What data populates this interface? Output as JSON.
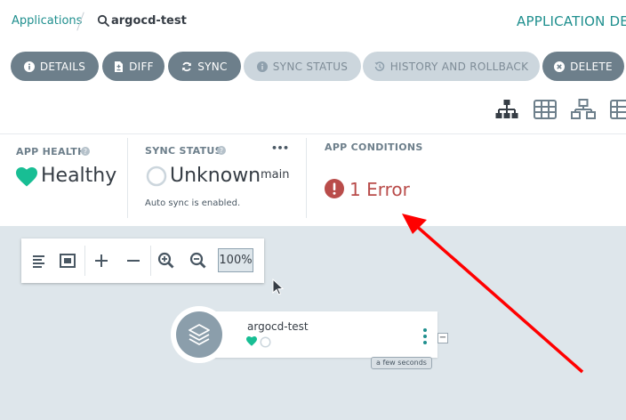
{
  "breadcrumb": {
    "root": "Applications",
    "current": "argocd-test"
  },
  "header": {
    "title": "APPLICATION DET"
  },
  "actions": [
    {
      "label": "DETAILS",
      "icon": "info-icon",
      "enabled": true
    },
    {
      "label": "DIFF",
      "icon": "file-diff-icon",
      "enabled": true
    },
    {
      "label": "SYNC",
      "icon": "sync-icon",
      "enabled": true
    },
    {
      "label": "SYNC STATUS",
      "icon": "info-icon",
      "enabled": false
    },
    {
      "label": "HISTORY AND ROLLBACK",
      "icon": "history-icon",
      "enabled": false
    },
    {
      "label": "DELETE",
      "icon": "close-circle-icon",
      "enabled": true
    }
  ],
  "views": [
    "tree-view-icon",
    "pods-view-icon",
    "network-view-icon",
    "list-view-icon"
  ],
  "status": {
    "health_label": "APP HEALTH",
    "health_value": "Healthy",
    "sync_label": "SYNC STATUS",
    "sync_value": "Unknown",
    "sync_revision": "main",
    "sync_note": "Auto sync is enabled.",
    "more": "•••",
    "conditions_label": "APP CONDITIONS",
    "conditions_value": "1 Error"
  },
  "graph_toolbar": {
    "zoom": "100%"
  },
  "node": {
    "name": "argocd-test",
    "age": "a few seconds",
    "collapse": "−"
  },
  "colors": {
    "accent": "#1f8f8e",
    "button": "#6d7f8b",
    "button_disabled": "#ccd6dd",
    "healthy": "#18be94",
    "error": "#b94c4a",
    "canvas": "#dee6eb",
    "annotation_arrow": "#ff0000"
  }
}
